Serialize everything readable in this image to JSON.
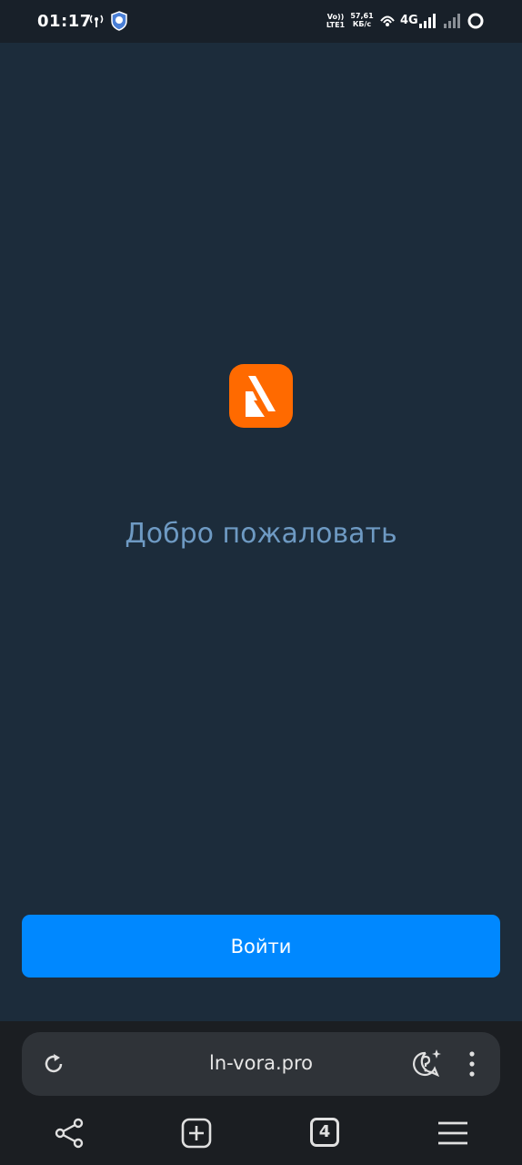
{
  "status_bar": {
    "time": "01:17",
    "volte": "Vo))",
    "lte": "LTE1",
    "speed_value": "57,61",
    "speed_unit": "КБ/с",
    "network": "4G"
  },
  "page": {
    "welcome_text": "Добро пожаловать",
    "login_button_label": "Войти"
  },
  "browser": {
    "url": "ln-vora.pro",
    "tab_count": "4"
  },
  "colors": {
    "background": "#1c2c3b",
    "accent_button": "#0088ff",
    "logo_orange": "#ff6a00",
    "welcome_text": "#6e9ac3"
  }
}
